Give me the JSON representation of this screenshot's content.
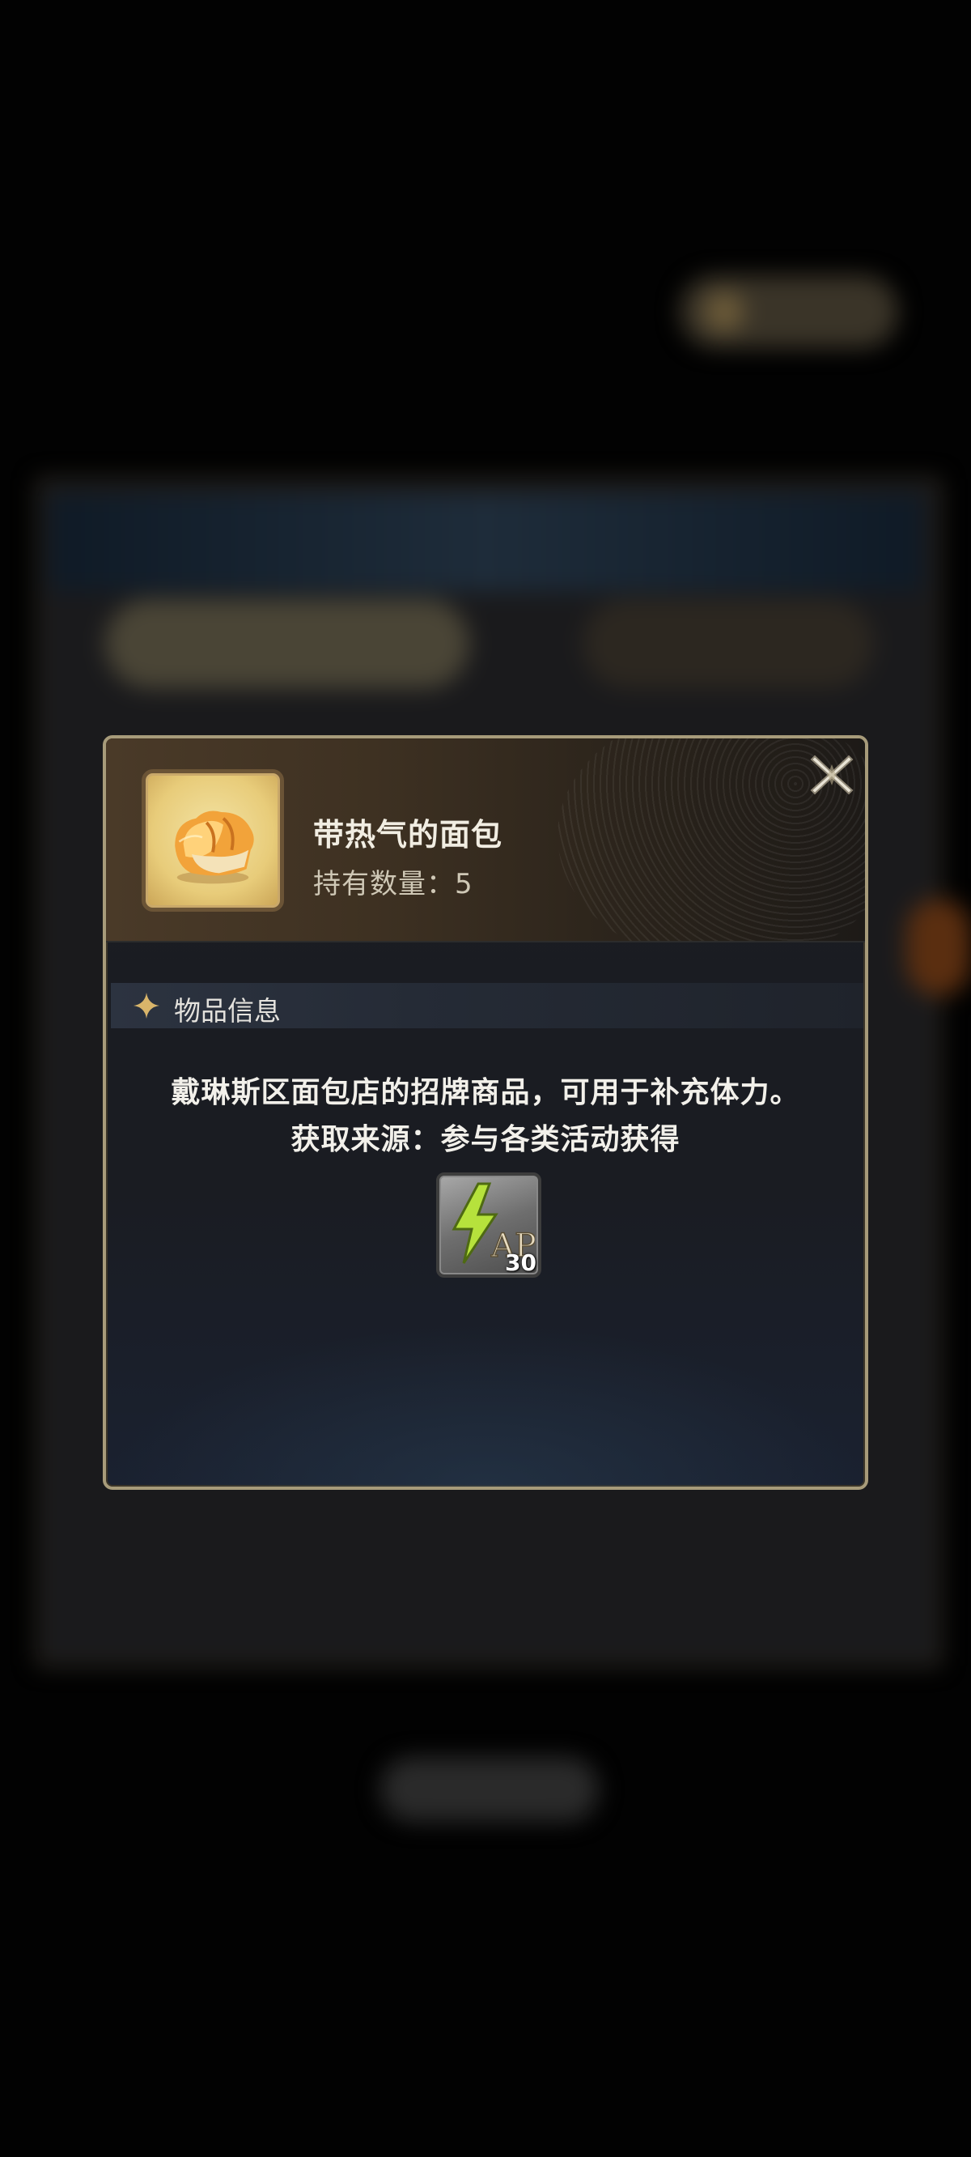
{
  "dialog": {
    "item": {
      "name": "带热气的面包",
      "count_text": "持有数量：5",
      "icon": "bread-icon"
    },
    "close_icon": "close-icon",
    "section": {
      "icon": "sparkle-icon",
      "title": "物品信息"
    },
    "description": {
      "line1": "戴琳斯区面包店的招牌商品，可用于补充体力。",
      "line2": "获取来源：参与各类活动获得"
    },
    "reward": {
      "icon": "ap-lightning-icon",
      "label": "AP",
      "amount": "30"
    }
  },
  "colors": {
    "border": "#a79b7a",
    "accent_gold": "#d9b56a",
    "text_primary": "#f2f0ea",
    "ap_green": "#b6e23c"
  }
}
